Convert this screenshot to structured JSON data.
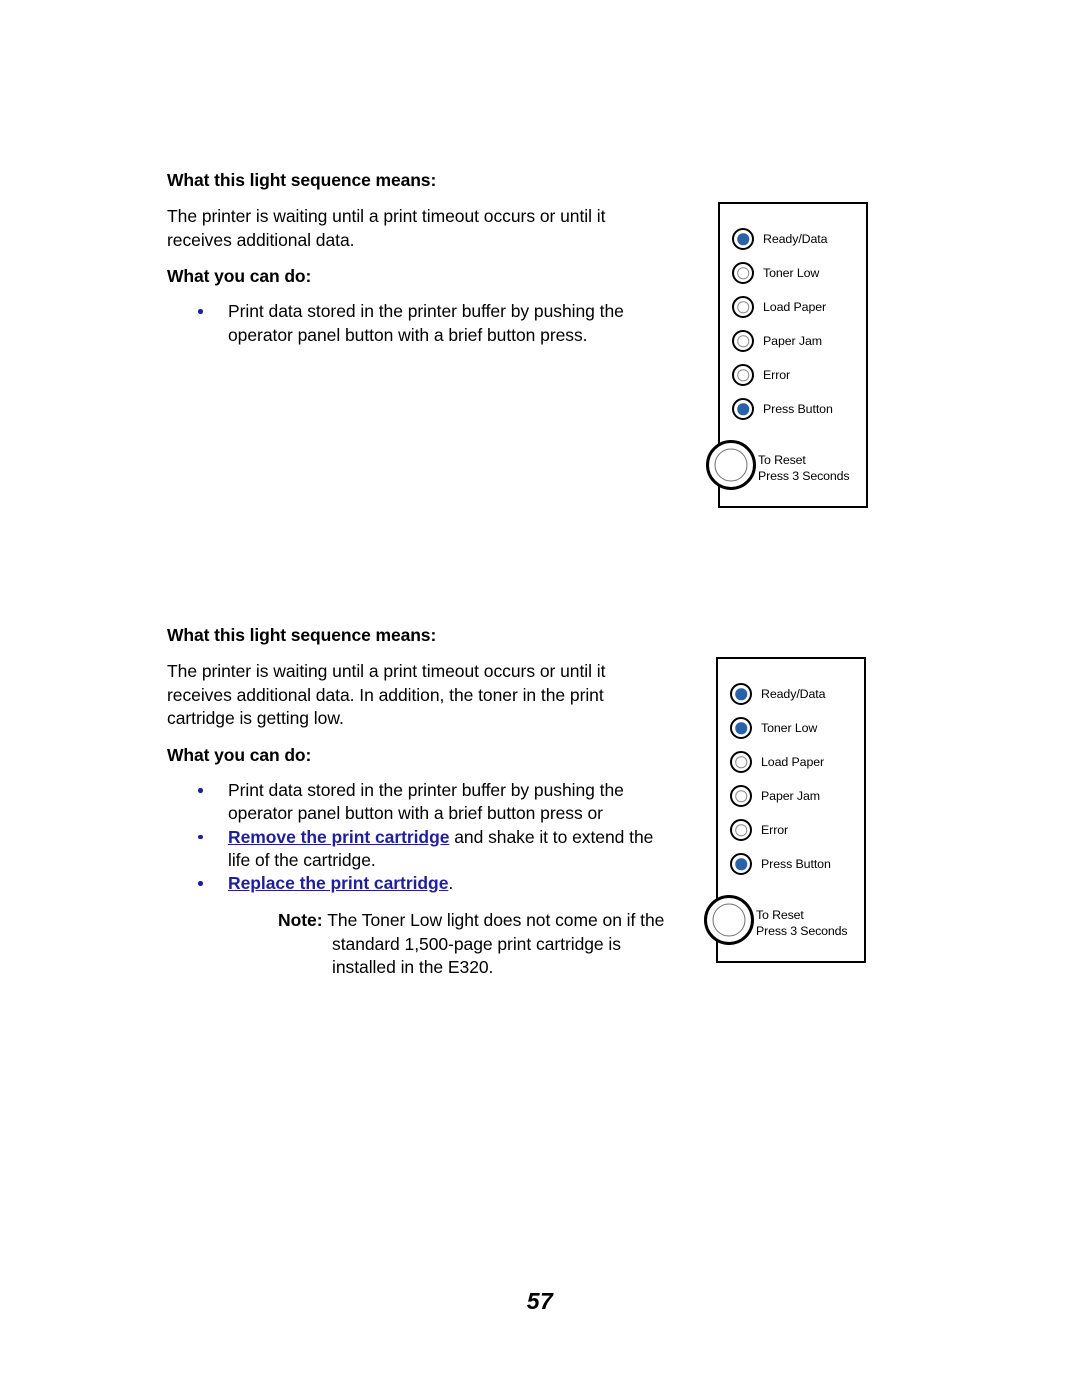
{
  "document": {
    "page_number": "57",
    "link_color": "#1f1f9e",
    "led_on_color": "#2a62a8"
  },
  "sections": [
    {
      "means_heading": "What this light sequence means:",
      "means_text": "The printer is waiting until a print timeout occurs or until it receives additional data.",
      "do_heading": "What you can do:",
      "bullets": [
        {
          "text": "Print data stored in the printer buffer by pushing the operator panel button with a brief button press."
        }
      ]
    },
    {
      "means_heading": "What this light sequence means:",
      "means_text": "The printer is waiting until a print timeout occurs or until it receives additional data. In addition, the toner in the print cartridge is getting low.",
      "do_heading": "What you can do:",
      "bullets": [
        {
          "text": "Print data stored in the printer buffer by pushing the operator panel button with a brief button press or"
        },
        {
          "link": "Remove the print cartridge",
          "text": " and shake it to extend the life of the cartridge."
        },
        {
          "link": "Replace the print cartridge",
          "text": "."
        }
      ],
      "note": {
        "label": "Note:",
        "text": "The Toner Low light does not come on if the standard 1,500-page print cartridge is installed in the E320."
      }
    }
  ],
  "panels": [
    {
      "name": "light-sequence-panel-1",
      "leds": [
        {
          "label": "Ready/Data",
          "state": "on"
        },
        {
          "label": "Toner Low",
          "state": "off"
        },
        {
          "label": "Load Paper",
          "state": "off"
        },
        {
          "label": "Paper Jam",
          "state": "off"
        },
        {
          "label": "Error",
          "state": "off"
        },
        {
          "label": "Press Button",
          "state": "on"
        }
      ],
      "reset_line1": "To Reset",
      "reset_line2": "Press 3 Seconds"
    },
    {
      "name": "light-sequence-panel-2",
      "leds": [
        {
          "label": "Ready/Data",
          "state": "on"
        },
        {
          "label": "Toner Low",
          "state": "on"
        },
        {
          "label": "Load Paper",
          "state": "off"
        },
        {
          "label": "Paper Jam",
          "state": "off"
        },
        {
          "label": "Error",
          "state": "off"
        },
        {
          "label": "Press Button",
          "state": "on"
        }
      ],
      "reset_line1": "To Reset",
      "reset_line2": "Press 3 Seconds"
    }
  ]
}
